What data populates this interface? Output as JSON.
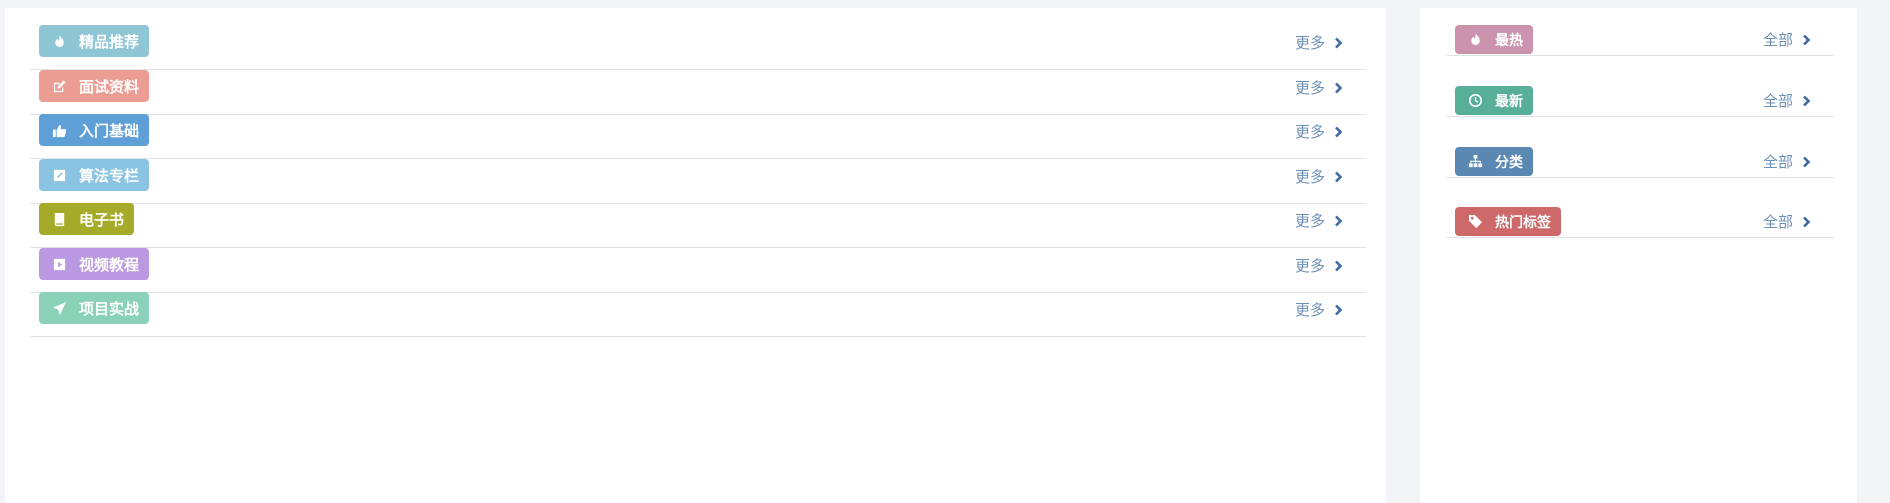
{
  "main": {
    "sections": [
      {
        "label": "精品推荐",
        "more": "更多",
        "icon": "fire-icon",
        "color": "#8ec6d6"
      },
      {
        "label": "面试资料",
        "more": "更多",
        "icon": "edit-icon",
        "color": "#ec9d93"
      },
      {
        "label": "入门基础",
        "more": "更多",
        "icon": "thumbs-up-icon",
        "color": "#5d9fd6"
      },
      {
        "label": "算法专栏",
        "more": "更多",
        "icon": "pencil-square-icon",
        "color": "#8bc4e2"
      },
      {
        "label": "电子书",
        "more": "更多",
        "icon": "book-icon",
        "color": "#a5aa29"
      },
      {
        "label": "视频教程",
        "more": "更多",
        "icon": "play-square-icon",
        "color": "#bb98e2"
      },
      {
        "label": "项目实战",
        "more": "更多",
        "icon": "paper-plane-icon",
        "color": "#8ad2b7"
      }
    ]
  },
  "sidebar": {
    "sections": [
      {
        "label": "最热",
        "more": "全部",
        "icon": "fire-icon",
        "color": "#cb93ad"
      },
      {
        "label": "最新",
        "more": "全部",
        "icon": "clock-icon",
        "color": "#57af98"
      },
      {
        "label": "分类",
        "more": "全部",
        "icon": "sitemap-icon",
        "color": "#5b88b3"
      },
      {
        "label": "热门标签",
        "more": "全部",
        "icon": "tag-icon",
        "color": "#cd6969"
      }
    ]
  }
}
